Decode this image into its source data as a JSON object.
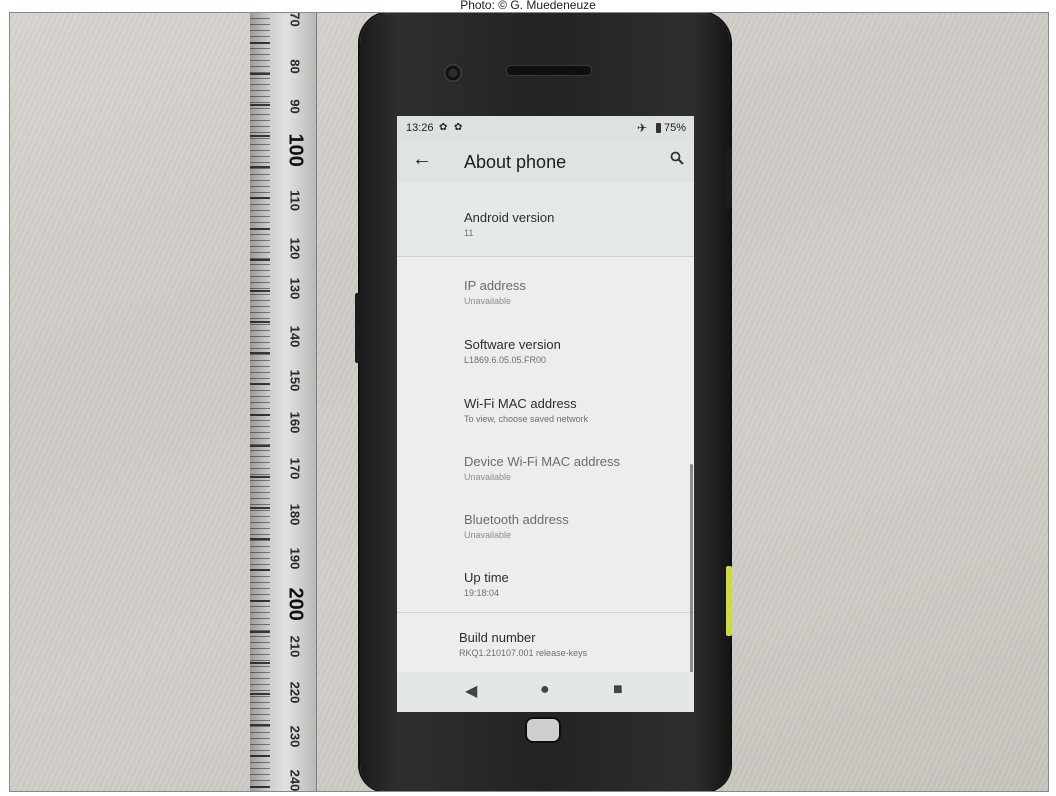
{
  "caption": "Photo: © G. Muedeneuze",
  "ruler": {
    "labels": [
      "70",
      "80",
      "90",
      "100",
      "110",
      "120",
      "130",
      "140",
      "150",
      "160",
      "170",
      "180",
      "190",
      "200",
      "210",
      "220",
      "230",
      "240"
    ]
  },
  "status_bar": {
    "time": "13:26",
    "icons": [
      "gear-icon",
      "gear-icon",
      "airplane-icon",
      "battery-icon"
    ],
    "battery": "75%"
  },
  "app_bar": {
    "title": "About phone",
    "icons": [
      "back-arrow-icon",
      "search-icon"
    ]
  },
  "settings_items": [
    {
      "title": "Android version",
      "subtitle": "11"
    },
    {
      "title": "IP address",
      "subtitle": "Unavailable"
    },
    {
      "title": "Software version",
      "subtitle": "L1869.6.05.05.FR00"
    },
    {
      "title": "Wi-Fi MAC address",
      "subtitle": "To view, choose saved network"
    },
    {
      "title": "Device Wi-Fi MAC address",
      "subtitle": "Unavailable"
    },
    {
      "title": "Bluetooth address",
      "subtitle": "Unavailable"
    },
    {
      "title": "Up time",
      "subtitle": "19:18:04"
    },
    {
      "title": "Build number",
      "subtitle": "RKQ1.210107.001 release-keys"
    }
  ],
  "nav_bar": {
    "icons": [
      "back-triangle-icon",
      "home-circle-icon",
      "recents-square-icon"
    ]
  }
}
